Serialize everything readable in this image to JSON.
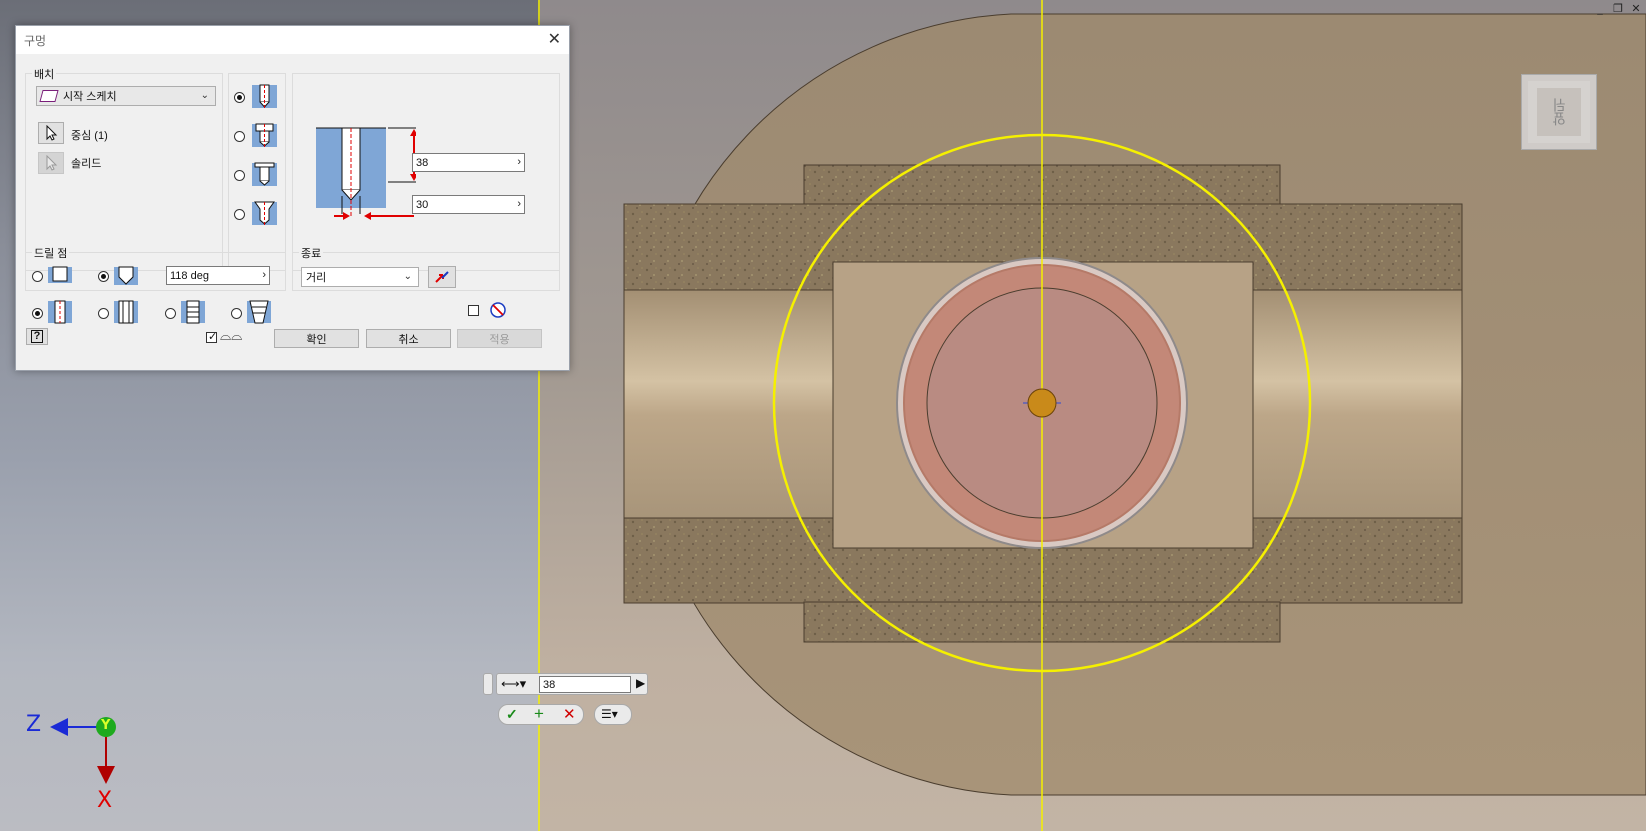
{
  "window": {
    "controls": [
      "_",
      "❐",
      "✕"
    ]
  },
  "viewcube": {
    "face_label": "앞뒤"
  },
  "dialog": {
    "title": "구멍",
    "placement": {
      "label": "배치",
      "dropdown_value": "시작 스케치",
      "center_label": "중심 (1)",
      "solid_label": "솔리드"
    },
    "dimensions": {
      "depth_value": "38",
      "diameter_value": "30"
    },
    "drill_point": {
      "label": "드릴 점",
      "angle_value": "118 deg"
    },
    "termination": {
      "label": "종료",
      "dropdown_value": "거리"
    },
    "buttons": {
      "ok": "확인",
      "cancel": "취소",
      "apply": "적용"
    }
  },
  "mini_toolbar": {
    "value": "38"
  },
  "axes": {
    "z_label": "Z",
    "y_label": "Y",
    "x_label": "X"
  },
  "colors": {
    "dialog_bg": "#f0f0f0",
    "accent_red": "#e00000",
    "sketch_yellow": "#f5f000",
    "hole_fill": "#c38878"
  }
}
